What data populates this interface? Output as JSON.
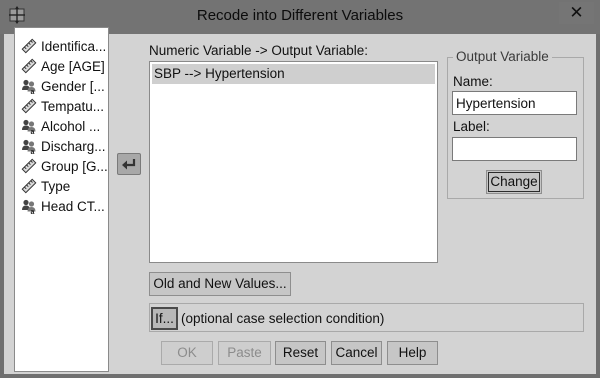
{
  "window": {
    "title": "Recode into Different Variables",
    "close_glyph": "✕",
    "app_icon": "spss-dialog-icon"
  },
  "source_variables": [
    {
      "label": "Identifica...",
      "icon": "ruler-scale-icon"
    },
    {
      "label": "Age [AGE]",
      "icon": "ruler-scale-icon"
    },
    {
      "label": "Gender [...",
      "icon": "nominal-people-icon"
    },
    {
      "label": "Tempatu...",
      "icon": "ruler-scale-icon"
    },
    {
      "label": "Alcohol ...",
      "icon": "nominal-people-icon"
    },
    {
      "label": "Discharg...",
      "icon": "nominal-people-icon"
    },
    {
      "label": "Group [G...",
      "icon": "ruler-scale-icon"
    },
    {
      "label": "Type",
      "icon": "ruler-scale-icon"
    },
    {
      "label": "Head CT...",
      "icon": "nominal-people-icon"
    }
  ],
  "numeric_variable": {
    "label": "Numeric Variable -> Output Variable:",
    "rows": [
      "SBP --> Hypertension"
    ]
  },
  "output_variable": {
    "legend": "Output Variable",
    "name_label": "Name:",
    "name_value": "Hypertension",
    "label_label": "Label:",
    "label_value": "",
    "change_button": "Change"
  },
  "buttons": {
    "old_new_values": "Old and New Values...",
    "if": "If...",
    "if_condition_text": "(optional case selection condition)",
    "ok": "OK",
    "paste": "Paste",
    "reset": "Reset",
    "cancel": "Cancel",
    "help": "Help"
  }
}
